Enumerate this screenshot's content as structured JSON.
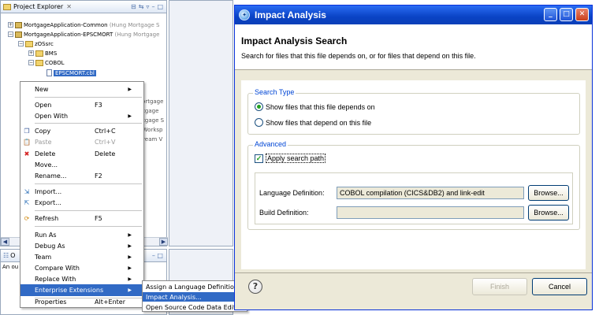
{
  "explorer": {
    "tab_label": "Project Explorer",
    "tab_close": "✕",
    "tree": [
      {
        "text": "MortgageApplication-Common",
        "suffix": "(Hung Mortgage S"
      },
      {
        "text": "MortgageApplication-EPSCMORT",
        "suffix": "(Hung Mortgage"
      },
      {
        "text": "zOSsrc"
      },
      {
        "text": "BMS"
      },
      {
        "text": "COBOL"
      },
      {
        "text": "EPSCMORT.cbl"
      }
    ],
    "clipped_suffixes": [
      "Mortgage",
      "ortgage",
      "ortgage S",
      "n Worksp",
      "Stream V"
    ]
  },
  "outline": {
    "tab_label": "O",
    "text": "An ou"
  },
  "context_menu": {
    "items": [
      {
        "label": "New",
        "shortcut": "",
        "submenu": true,
        "disabled": false
      },
      {
        "label": "Open",
        "shortcut": "F3",
        "submenu": false,
        "disabled": false
      },
      {
        "label": "Open With",
        "shortcut": "",
        "submenu": true,
        "disabled": false
      },
      {
        "label": "Copy",
        "shortcut": "Ctrl+C",
        "submenu": false,
        "disabled": false
      },
      {
        "label": "Paste",
        "shortcut": "Ctrl+V",
        "submenu": false,
        "disabled": true
      },
      {
        "label": "Delete",
        "shortcut": "Delete",
        "submenu": false,
        "disabled": false
      },
      {
        "label": "Move...",
        "shortcut": "",
        "submenu": false,
        "disabled": false
      },
      {
        "label": "Rename...",
        "shortcut": "F2",
        "submenu": false,
        "disabled": false
      },
      {
        "label": "Import...",
        "shortcut": "",
        "submenu": false,
        "disabled": false
      },
      {
        "label": "Export...",
        "shortcut": "",
        "submenu": false,
        "disabled": false
      },
      {
        "label": "Refresh",
        "shortcut": "F5",
        "submenu": false,
        "disabled": false
      },
      {
        "label": "Run As",
        "shortcut": "",
        "submenu": true,
        "disabled": false
      },
      {
        "label": "Debug As",
        "shortcut": "",
        "submenu": true,
        "disabled": false
      },
      {
        "label": "Team",
        "shortcut": "",
        "submenu": true,
        "disabled": false
      },
      {
        "label": "Compare With",
        "shortcut": "",
        "submenu": true,
        "disabled": false
      },
      {
        "label": "Replace With",
        "shortcut": "",
        "submenu": true,
        "disabled": false
      },
      {
        "label": "Enterprise Extensions",
        "shortcut": "",
        "submenu": true,
        "disabled": false
      },
      {
        "label": "Properties",
        "shortcut": "Alt+Enter",
        "submenu": false,
        "disabled": false
      }
    ],
    "submenu_items": [
      {
        "label": "Assign a Language Definition..."
      },
      {
        "label": "Impact Analysis..."
      },
      {
        "label": "Open Source Code Data Editor"
      }
    ]
  },
  "dialog": {
    "title": "Impact Analysis",
    "header_title": "Impact Analysis Search",
    "header_desc": "Search for files that this file depends on, or for files that depend on this file.",
    "search_type": {
      "legend": "Search Type",
      "option_depends_on": "Show files that this file depends on",
      "option_depend_on_this": "Show files that depend on this file",
      "selected": "depends_on"
    },
    "advanced": {
      "legend": "Advanced",
      "apply_search_path": "Apply search path",
      "apply_checked": true,
      "language_definition_label": "Language Definition:",
      "language_definition_value": "COBOL compilation (CICS&DB2) and link-edit",
      "build_definition_label": "Build Definition:",
      "build_definition_value": "",
      "browse_label": "Browse..."
    },
    "finish_label": "Finish",
    "cancel_label": "Cancel",
    "help_glyph": "?"
  }
}
